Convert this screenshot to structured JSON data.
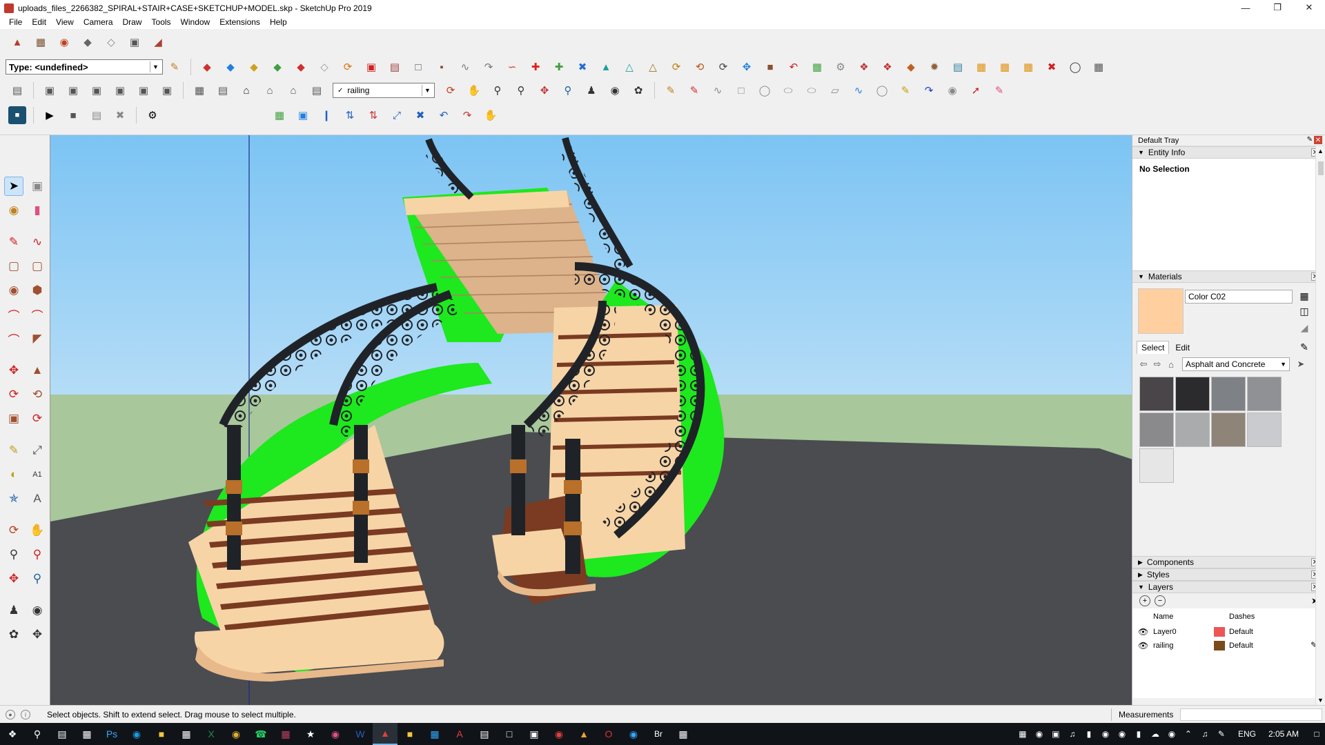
{
  "window": {
    "title": "uploads_files_2266382_SPIRAL+STAIR+CASE+SKETCHUP+MODEL.skp - SketchUp Pro 2019",
    "controls": [
      "minimize-icon",
      "restore-icon",
      "close-icon"
    ]
  },
  "menu": {
    "items": [
      "File",
      "Edit",
      "View",
      "Camera",
      "Draw",
      "Tools",
      "Window",
      "Extensions",
      "Help"
    ]
  },
  "toolbar": {
    "type_value": "Type: <undefined>",
    "layer_value": "railing"
  },
  "tray": {
    "title": "Default Tray",
    "entity_info": {
      "header": "Entity Info",
      "selection": "No Selection"
    },
    "materials": {
      "header": "Materials",
      "current_name": "Color C02",
      "current_color": "#ffcf9f",
      "tab_select": "Select",
      "tab_edit": "Edit",
      "collection": "Asphalt and Concrete",
      "swatches": [
        "#4a4548",
        "#2b2b2d",
        "#7e8286",
        "#8f9194",
        "#8a8a8c",
        "#a9abac",
        "#8f8478",
        "#c9cbce",
        "#e6e6e6"
      ]
    },
    "components_header": "Components",
    "styles_header": "Styles",
    "layers": {
      "header": "Layers",
      "col_name": "Name",
      "col_dashes": "Dashes",
      "rows": [
        {
          "name": "Layer0",
          "color": "#ee5555",
          "dashes": "Default"
        },
        {
          "name": "railing",
          "color": "#7a4a1a",
          "dashes": "Default"
        }
      ]
    }
  },
  "status": {
    "message": "Select objects. Shift to extend select. Drag mouse to select multiple.",
    "measurements_label": "Measurements"
  },
  "taskbar": {
    "language": "ENG",
    "time": "2:05 AM"
  },
  "viewport": {
    "sky_color": "#8fcdf2",
    "ground_color": "#a8c79b",
    "floor_color": "#4a4c50",
    "stringer_color": "#1ee81e",
    "tread_color": "#f7d4a6",
    "riser_color": "#7a3b22",
    "rail_color": "#1f2328"
  }
}
